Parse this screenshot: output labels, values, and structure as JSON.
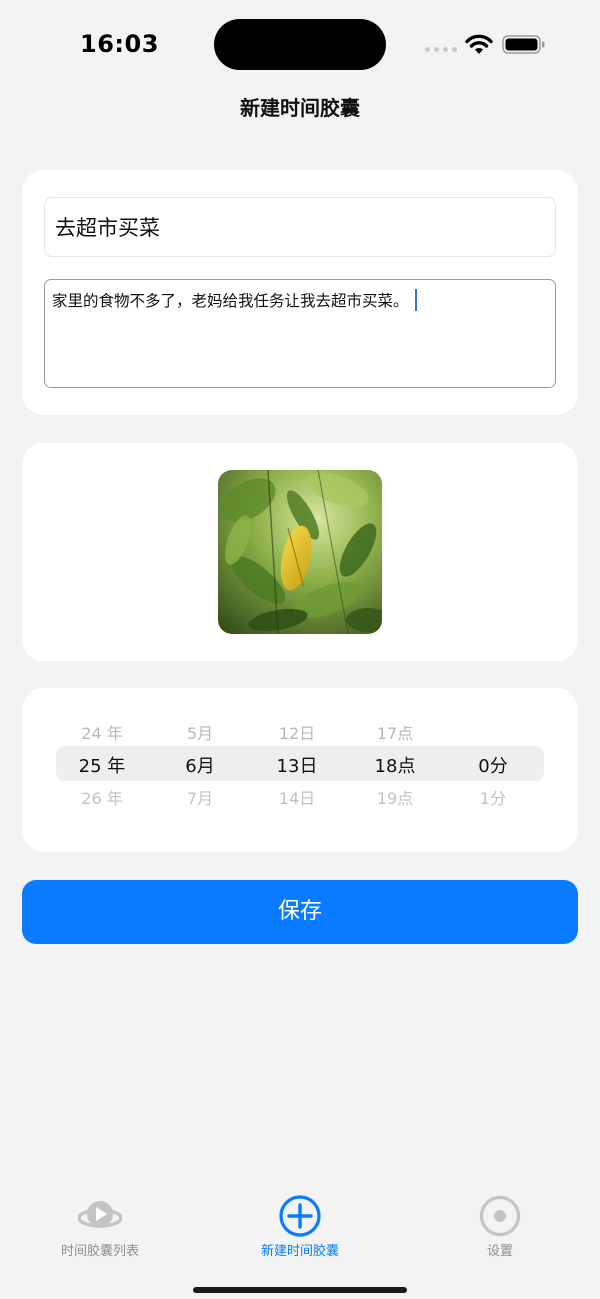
{
  "status_bar": {
    "time": "16:03"
  },
  "nav": {
    "title": "新建时间胶囊"
  },
  "form": {
    "title_value": "去超市买菜",
    "content_value": "家里的食物不多了，老妈给我任务让我去超市买菜。"
  },
  "image": {
    "description_icon": "photo-leaves"
  },
  "picker": {
    "columns": [
      {
        "name": "year",
        "prev": "24 年",
        "current": "25 年",
        "next": "26 年"
      },
      {
        "name": "month",
        "prev": "5月",
        "current": "6月",
        "next": "7月"
      },
      {
        "name": "day",
        "prev": "12日",
        "current": "13日",
        "next": "14日"
      },
      {
        "name": "hour",
        "prev": "17点",
        "current": "18点",
        "next": "19点"
      },
      {
        "name": "minute",
        "prev": "",
        "current": "0分",
        "next": "1分"
      }
    ]
  },
  "actions": {
    "save_label": "保存"
  },
  "tabbar": {
    "items": [
      {
        "label": "时间胶囊列表",
        "icon": "capsule-list-icon",
        "active": false
      },
      {
        "label": "新建时间胶囊",
        "icon": "plus-circle-icon",
        "active": true
      },
      {
        "label": "设置",
        "icon": "settings-icon",
        "active": false
      }
    ]
  },
  "colors": {
    "accent": "#0a7cff",
    "background": "#f3f3f4",
    "card": "#ffffff",
    "inactive": "#8e8e93"
  }
}
